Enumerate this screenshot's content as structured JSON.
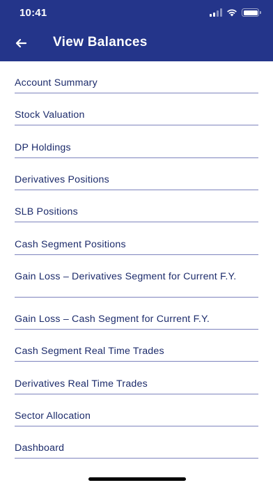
{
  "status_bar": {
    "time": "10:41",
    "icons": [
      "cellular-signal-icon",
      "wifi-icon",
      "battery-icon"
    ]
  },
  "nav": {
    "title": "View Balances",
    "back_icon": "arrow-left-icon"
  },
  "colors": {
    "header_bg": "#24358a",
    "menu_text": "#1c2b6b",
    "divider": "#7d83bd",
    "background": "#ffffff"
  },
  "menu": {
    "items": [
      {
        "label": "Account Summary"
      },
      {
        "label": "Stock Valuation"
      },
      {
        "label": "DP Holdings"
      },
      {
        "label": "Derivatives Positions"
      },
      {
        "label": "SLB Positions"
      },
      {
        "label": "Cash Segment Positions"
      },
      {
        "label": "Gain Loss – Derivatives Segment for Current F.Y."
      },
      {
        "label": "Gain Loss – Cash Segment for Current F.Y."
      },
      {
        "label": "Cash Segment Real Time Trades"
      },
      {
        "label": "Derivatives Real Time Trades"
      },
      {
        "label": "Sector Allocation"
      },
      {
        "label": "Dashboard"
      }
    ]
  }
}
